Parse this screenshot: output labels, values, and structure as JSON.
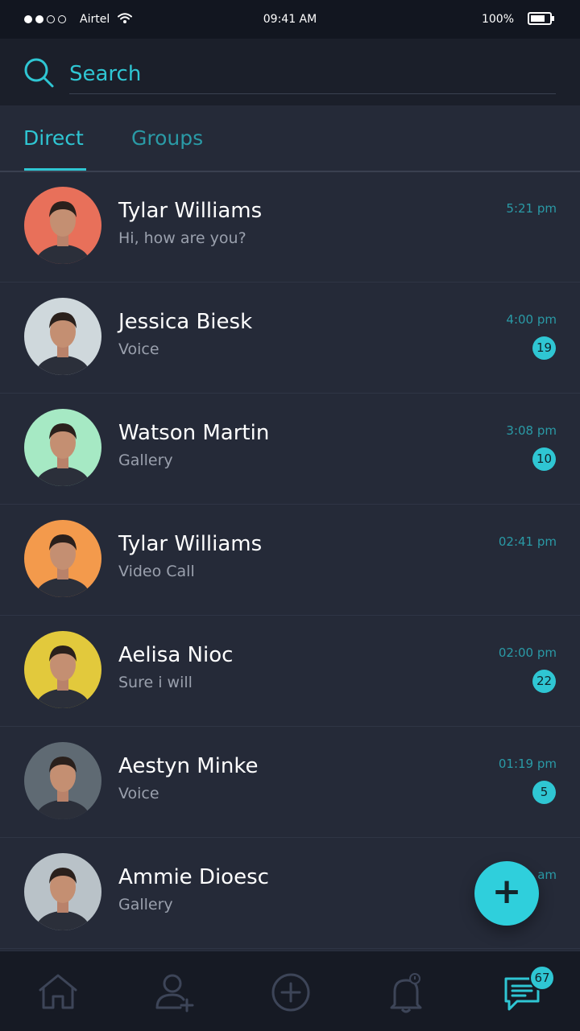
{
  "status_bar": {
    "carrier": "Airtel",
    "time": "09:41 AM",
    "battery": "100%"
  },
  "search": {
    "placeholder": "Search"
  },
  "tabs": [
    {
      "label": "Direct",
      "active": true
    },
    {
      "label": "Groups",
      "active": false
    }
  ],
  "conversations": [
    {
      "name": "Tylar Williams",
      "preview": "Hi, how are you?",
      "time": "5:21 pm",
      "unread": "",
      "avatar_bg": "#e8705a"
    },
    {
      "name": "Jessica Biesk",
      "preview": "Voice",
      "time": "4:00 pm",
      "unread": "19",
      "avatar_bg": "#cfd8dc"
    },
    {
      "name": "Watson Martin",
      "preview": "Gallery",
      "time": "3:08 pm",
      "unread": "10",
      "avatar_bg": "#a6e9c4"
    },
    {
      "name": "Tylar Williams",
      "preview": "Video Call",
      "time": "02:41 pm",
      "unread": "",
      "avatar_bg": "#f39a4c"
    },
    {
      "name": "Aelisa Nioc",
      "preview": "Sure i will",
      "time": "02:00 pm",
      "unread": "22",
      "avatar_bg": "#e2c93c"
    },
    {
      "name": "Aestyn Minke",
      "preview": "Voice",
      "time": "01:19 pm",
      "unread": "5",
      "avatar_bg": "#5f6a73"
    },
    {
      "name": "Ammie Dioesc",
      "preview": "Gallery",
      "time": "am",
      "unread": "",
      "avatar_bg": "#b9c2c8"
    }
  ],
  "fab": {
    "label": "+"
  },
  "bottom_nav": {
    "items": [
      "home-icon",
      "add-contact-icon",
      "add-circle-icon",
      "bell-icon",
      "chat-icon"
    ],
    "chat_badge": "67"
  },
  "colors": {
    "accent": "#2fc6d3",
    "background": "#252a38",
    "header": "#1b1f2a"
  }
}
